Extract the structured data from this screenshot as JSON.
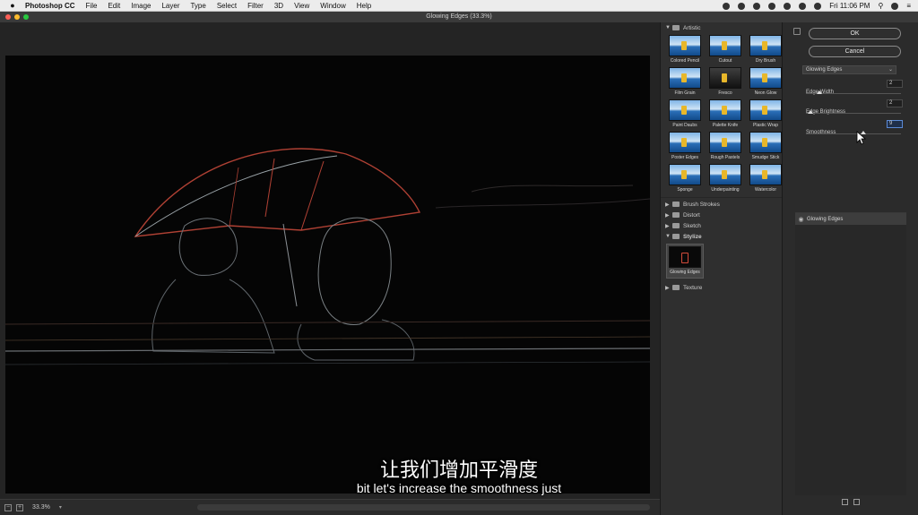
{
  "menubar": {
    "app_name": "Photoshop CC",
    "menus": [
      "File",
      "Edit",
      "Image",
      "Layer",
      "Type",
      "Select",
      "Filter",
      "3D",
      "View",
      "Window",
      "Help"
    ],
    "clock": "Fri 11:06 PM"
  },
  "window": {
    "title": "Glowing Edges (33.3%)"
  },
  "preview": {
    "zoom_level": "33.3%"
  },
  "subtitles": {
    "chinese": "让我们增加平滑度",
    "english": "bit let's increase the smoothness just"
  },
  "gallery": {
    "artistic": {
      "label": "Artistic",
      "filters": [
        "Colored Pencil",
        "Cutout",
        "Dry Brush",
        "Film Grain",
        "Fresco",
        "Neon Glow",
        "Paint Daubs",
        "Palette Knife",
        "Plastic Wrap",
        "Poster Edges",
        "Rough Pastels",
        "Smudge Stick",
        "Sponge",
        "Underpainting",
        "Watercolor"
      ]
    },
    "brush_strokes": {
      "label": "Brush Strokes"
    },
    "distort": {
      "label": "Distort"
    },
    "sketch": {
      "label": "Sketch"
    },
    "stylize": {
      "label": "Stylize",
      "filters": [
        "Glowing Edges"
      ]
    },
    "texture": {
      "label": "Texture"
    }
  },
  "settings": {
    "ok_label": "OK",
    "cancel_label": "Cancel",
    "selected_filter": "Glowing Edges",
    "params": [
      {
        "label": "Edge Width",
        "value": "2",
        "level": 0.14
      },
      {
        "label": "Edge Brightness",
        "value": "2",
        "level": 0.05
      },
      {
        "label": "Smoothness",
        "value": "9",
        "level": 0.6
      }
    ],
    "applied_layers": [
      "Glowing Edges"
    ]
  }
}
